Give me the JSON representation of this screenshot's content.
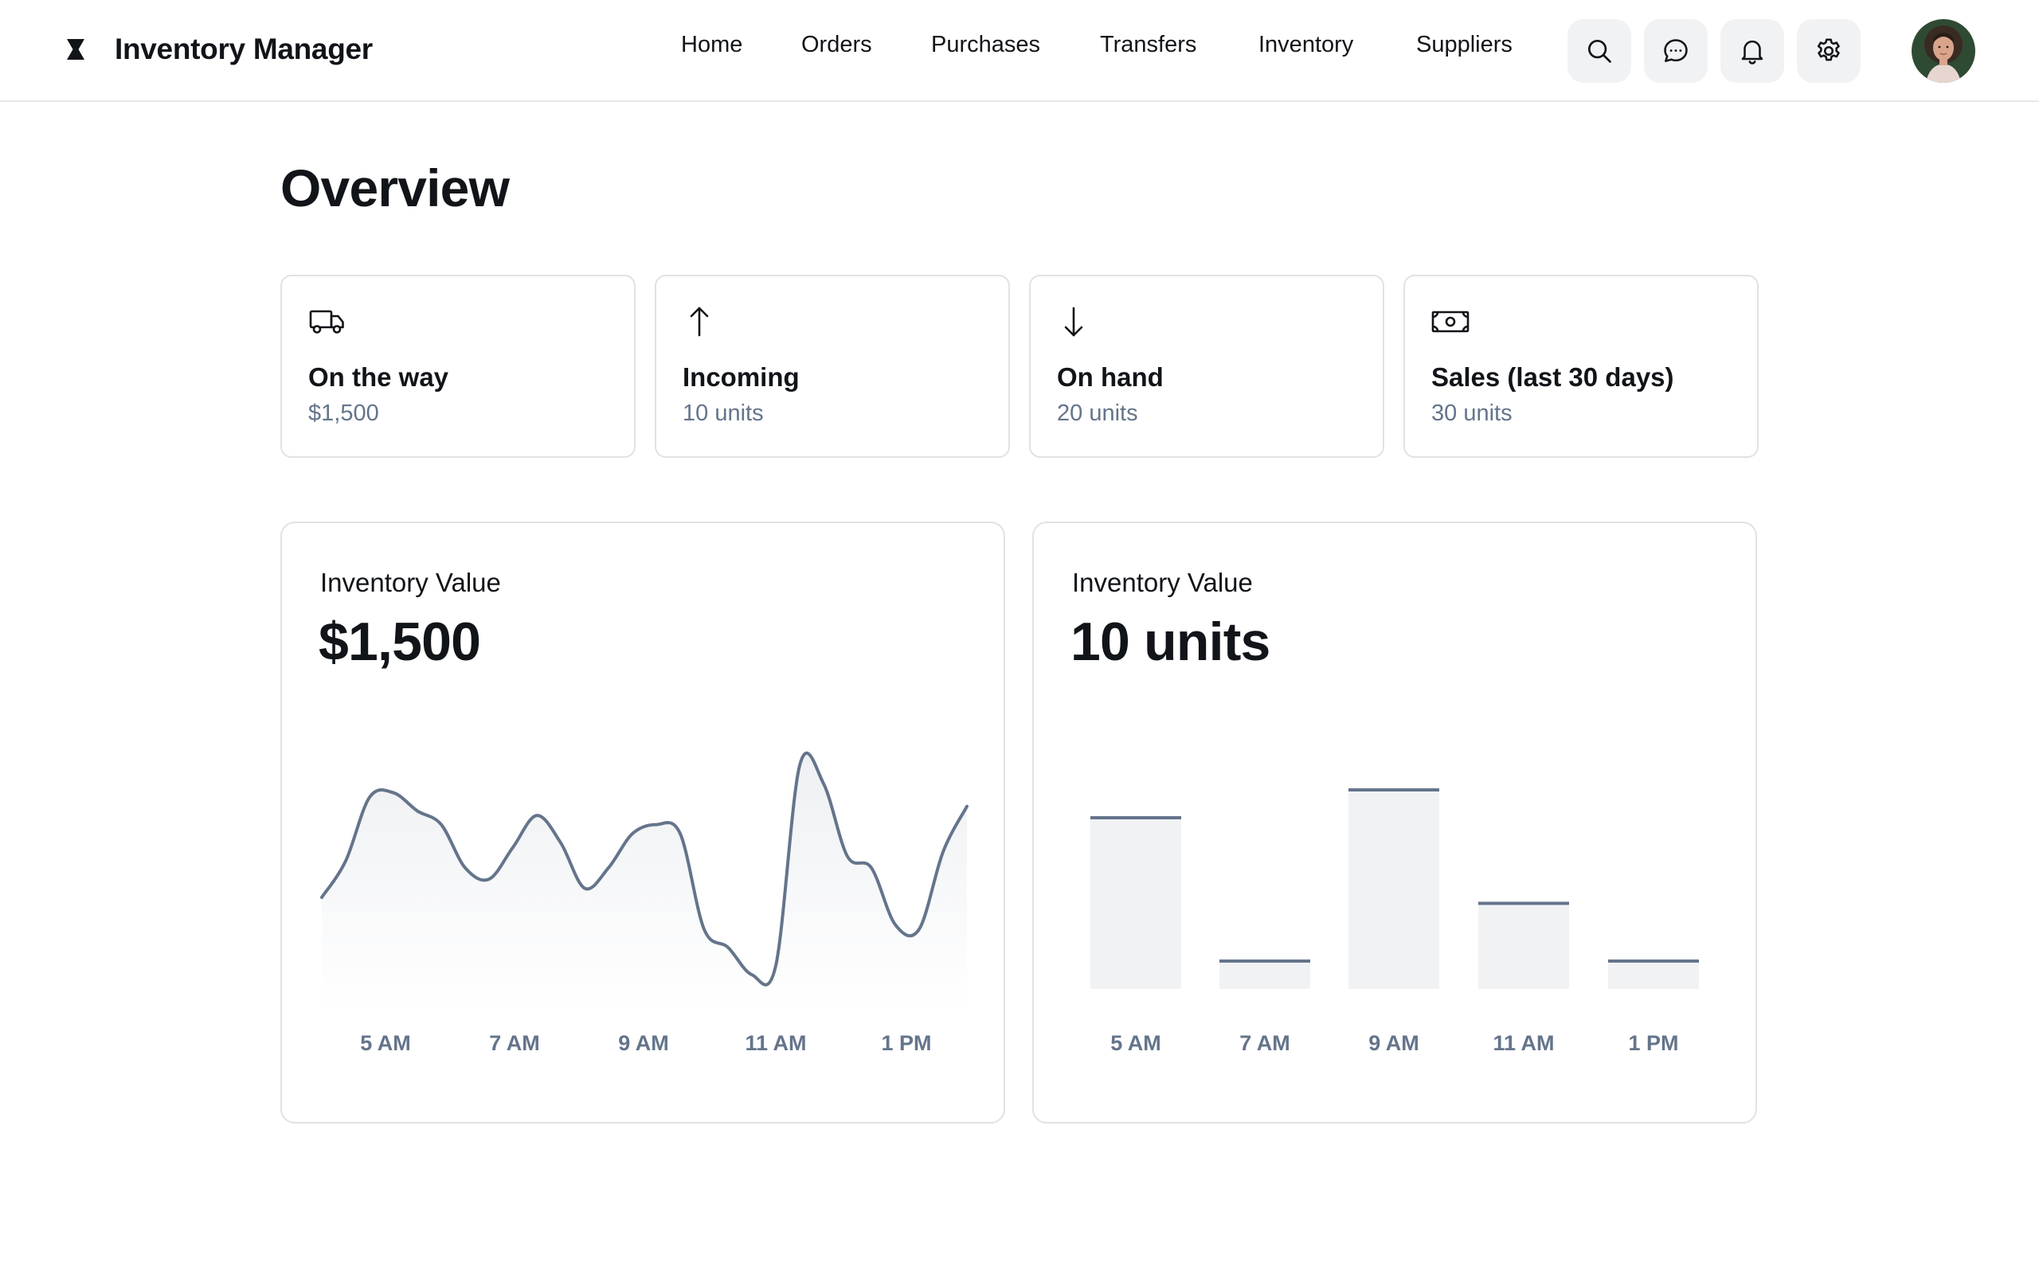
{
  "app": {
    "title": "Inventory Manager"
  },
  "nav": {
    "items": [
      {
        "label": "Home"
      },
      {
        "label": "Orders"
      },
      {
        "label": "Purchases"
      },
      {
        "label": "Transfers"
      },
      {
        "label": "Inventory"
      },
      {
        "label": "Suppliers"
      }
    ]
  },
  "header_actions": {
    "icons": [
      "search-icon",
      "chat-icon",
      "bell-icon",
      "gear-icon"
    ]
  },
  "page": {
    "title": "Overview"
  },
  "stats": [
    {
      "icon": "truck-icon",
      "label": "On the way",
      "value": "$1,500"
    },
    {
      "icon": "arrow-up-icon",
      "label": "Incoming",
      "value": "10 units"
    },
    {
      "icon": "arrow-down-icon",
      "label": "On hand",
      "value": "20 units"
    },
    {
      "icon": "banknote-icon",
      "label": "Sales (last 30 days)",
      "value": "30 units"
    }
  ],
  "cards": [
    {
      "label": "Inventory Value",
      "value": "$1,500"
    },
    {
      "label": "Inventory Value",
      "value": "10 units"
    }
  ],
  "colors": {
    "line": "#64748b",
    "bar_fill": "#f1f2f4",
    "bar_top": "#64748b",
    "muted_text": "#64748b",
    "border": "#dfe2e6"
  },
  "chart_data": [
    {
      "type": "area",
      "x": [
        "4:40 AM",
        "5:00 AM",
        "5:20 AM",
        "5:40 AM",
        "6:00 AM",
        "6:20 AM",
        "6:40 AM",
        "7:00 AM",
        "7:20 AM",
        "7:40 AM",
        "8:00 AM",
        "8:20 AM",
        "8:40 AM",
        "9:00 AM",
        "9:20 AM",
        "9:40 AM",
        "10:00 AM",
        "10:20 AM",
        "10:40 AM",
        "11:00 AM",
        "11:20 AM",
        "11:40 AM",
        "12:00 PM",
        "12:20 PM",
        "12:40 PM",
        "1:00 PM",
        "1:20 PM",
        "1:40 PM"
      ],
      "x_tick_labels": [
        "5 AM",
        "7 AM",
        "9 AM",
        "11 AM",
        "1 PM"
      ],
      "values": [
        42,
        58,
        86,
        88,
        80,
        74,
        55,
        50,
        64,
        78,
        66,
        46,
        55,
        70,
        74,
        70,
        28,
        20,
        8,
        12,
        100,
        92,
        60,
        55,
        30,
        28,
        62,
        82
      ],
      "ylim": [
        0,
        105
      ],
      "grid": false,
      "legend": "none"
    },
    {
      "type": "bar",
      "categories": [
        "5 AM",
        "7 AM",
        "9 AM",
        "11 AM",
        "1 PM"
      ],
      "values": [
        86,
        14,
        100,
        43,
        14
      ],
      "ylim": [
        0,
        100
      ],
      "grid": false,
      "legend": "none"
    }
  ]
}
